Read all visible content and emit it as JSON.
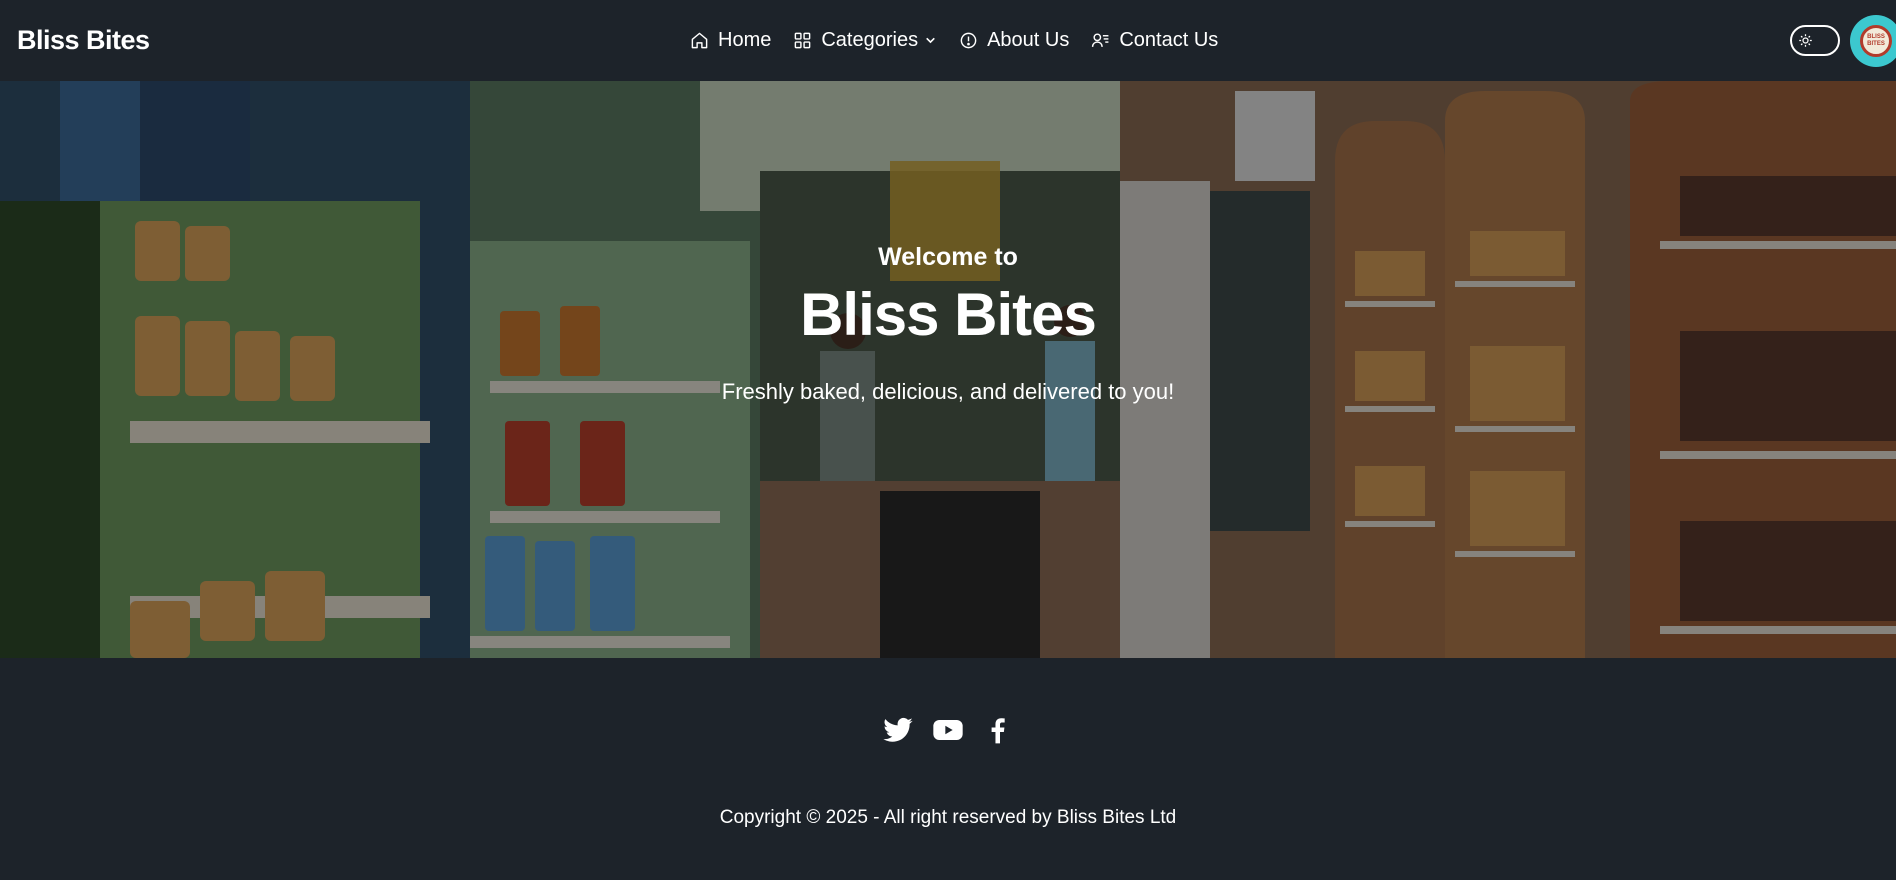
{
  "navbar": {
    "brand": "Bliss Bites",
    "items": [
      {
        "label": "Home",
        "icon": "home-icon"
      },
      {
        "label": "Categories",
        "icon": "grid-icon",
        "dropdown": true
      },
      {
        "label": "About Us",
        "icon": "info-icon"
      },
      {
        "label": "Contact Us",
        "icon": "contacts-icon"
      }
    ],
    "theme_toggle_icon": "sun-icon",
    "avatar_logo_text": "BLISS BITES"
  },
  "hero": {
    "welcome": "Welcome to",
    "title": "Bliss Bites",
    "subtitle": "Freshly baked, delicious, and delivered to you!"
  },
  "footer": {
    "social": [
      {
        "name": "twitter",
        "icon": "twitter-icon"
      },
      {
        "name": "youtube",
        "icon": "youtube-icon"
      },
      {
        "name": "facebook",
        "icon": "facebook-icon"
      }
    ],
    "copyright": "Copyright © 2025 - All right reserved by Bliss Bites Ltd"
  },
  "colors": {
    "background": "#1d232a",
    "text": "#ffffff",
    "avatar_bg": "#3cc8cf"
  }
}
